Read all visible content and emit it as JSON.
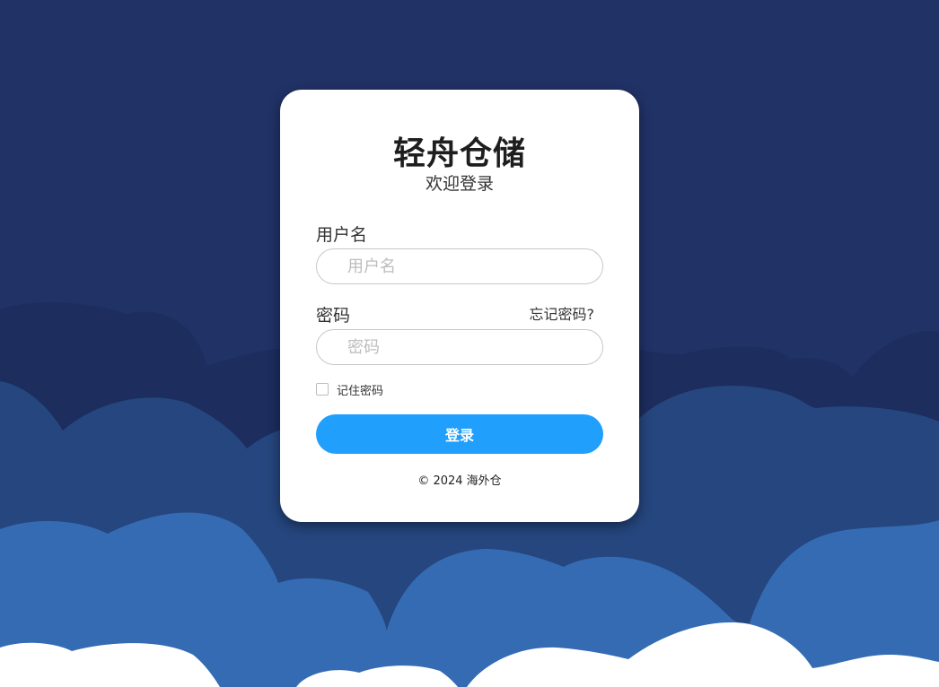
{
  "app": {
    "title": "轻舟仓储",
    "subtitle": "欢迎登录"
  },
  "form": {
    "username_label": "用户名",
    "username_placeholder": "用户名",
    "username_value": "",
    "password_label": "密码",
    "password_placeholder": "密码",
    "password_value": "",
    "forgot_link": "忘记密码?",
    "remember_label": "记住密码",
    "remember_checked": false,
    "login_button": "登录"
  },
  "footer": {
    "copyright": "© 2024 海外仓"
  },
  "colors": {
    "background": "#213267",
    "cloud_dark": "#1c2d5e",
    "cloud_mid": "#25467e",
    "cloud_light": "#346bb3",
    "cloud_white": "#ffffff",
    "card": "#ffffff",
    "button": "#209ffd",
    "button_text": "#ffffff"
  }
}
